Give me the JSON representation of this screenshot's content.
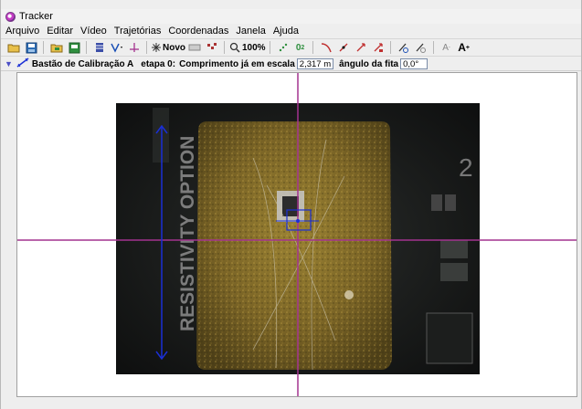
{
  "window": {
    "title": "Tracker"
  },
  "menu": [
    "Arquivo",
    "Editar",
    "Vídeo",
    "Trajetórias",
    "Coordenadas",
    "Janela",
    "Ajuda"
  ],
  "toolbar": {
    "new_label": "Novo",
    "zoom_label": "100%",
    "icons": [
      "open-folder-icon",
      "save-icon",
      "open-video-icon",
      "export-icon",
      "clip-settings-icon",
      "calibration-tool-icon",
      "axes-icon",
      "new-track-icon",
      "track-control-icon",
      "trails-icon",
      "zoom-icon",
      "points-icon",
      "velocity-icon",
      "acceleration-icon",
      "xmass-icon",
      "traces-icon",
      "autotracker-icon",
      "decrease-font-icon",
      "increase-font-icon"
    ],
    "font_small": "A",
    "font_large": "A",
    "sigma_label": "0",
    "sigma_sub": "2",
    "font_small_sup": "-",
    "font_large_sup": "+"
  },
  "calibration": {
    "tool_name": "Bastão de Calibração A",
    "step": "etapa 0:",
    "length_label": "Comprimento já em escala",
    "length_value": "2,317 m",
    "angle_label": "ângulo da fita",
    "angle_value": "0,0°"
  },
  "video": {
    "sample_text": "RESISTIVITY OPTION",
    "board_number": "2"
  },
  "colors": {
    "axis": "#a3338f",
    "calibration_stick": "#1a2fd6",
    "board": "#1b1d1c",
    "sample": "#8a7530"
  }
}
